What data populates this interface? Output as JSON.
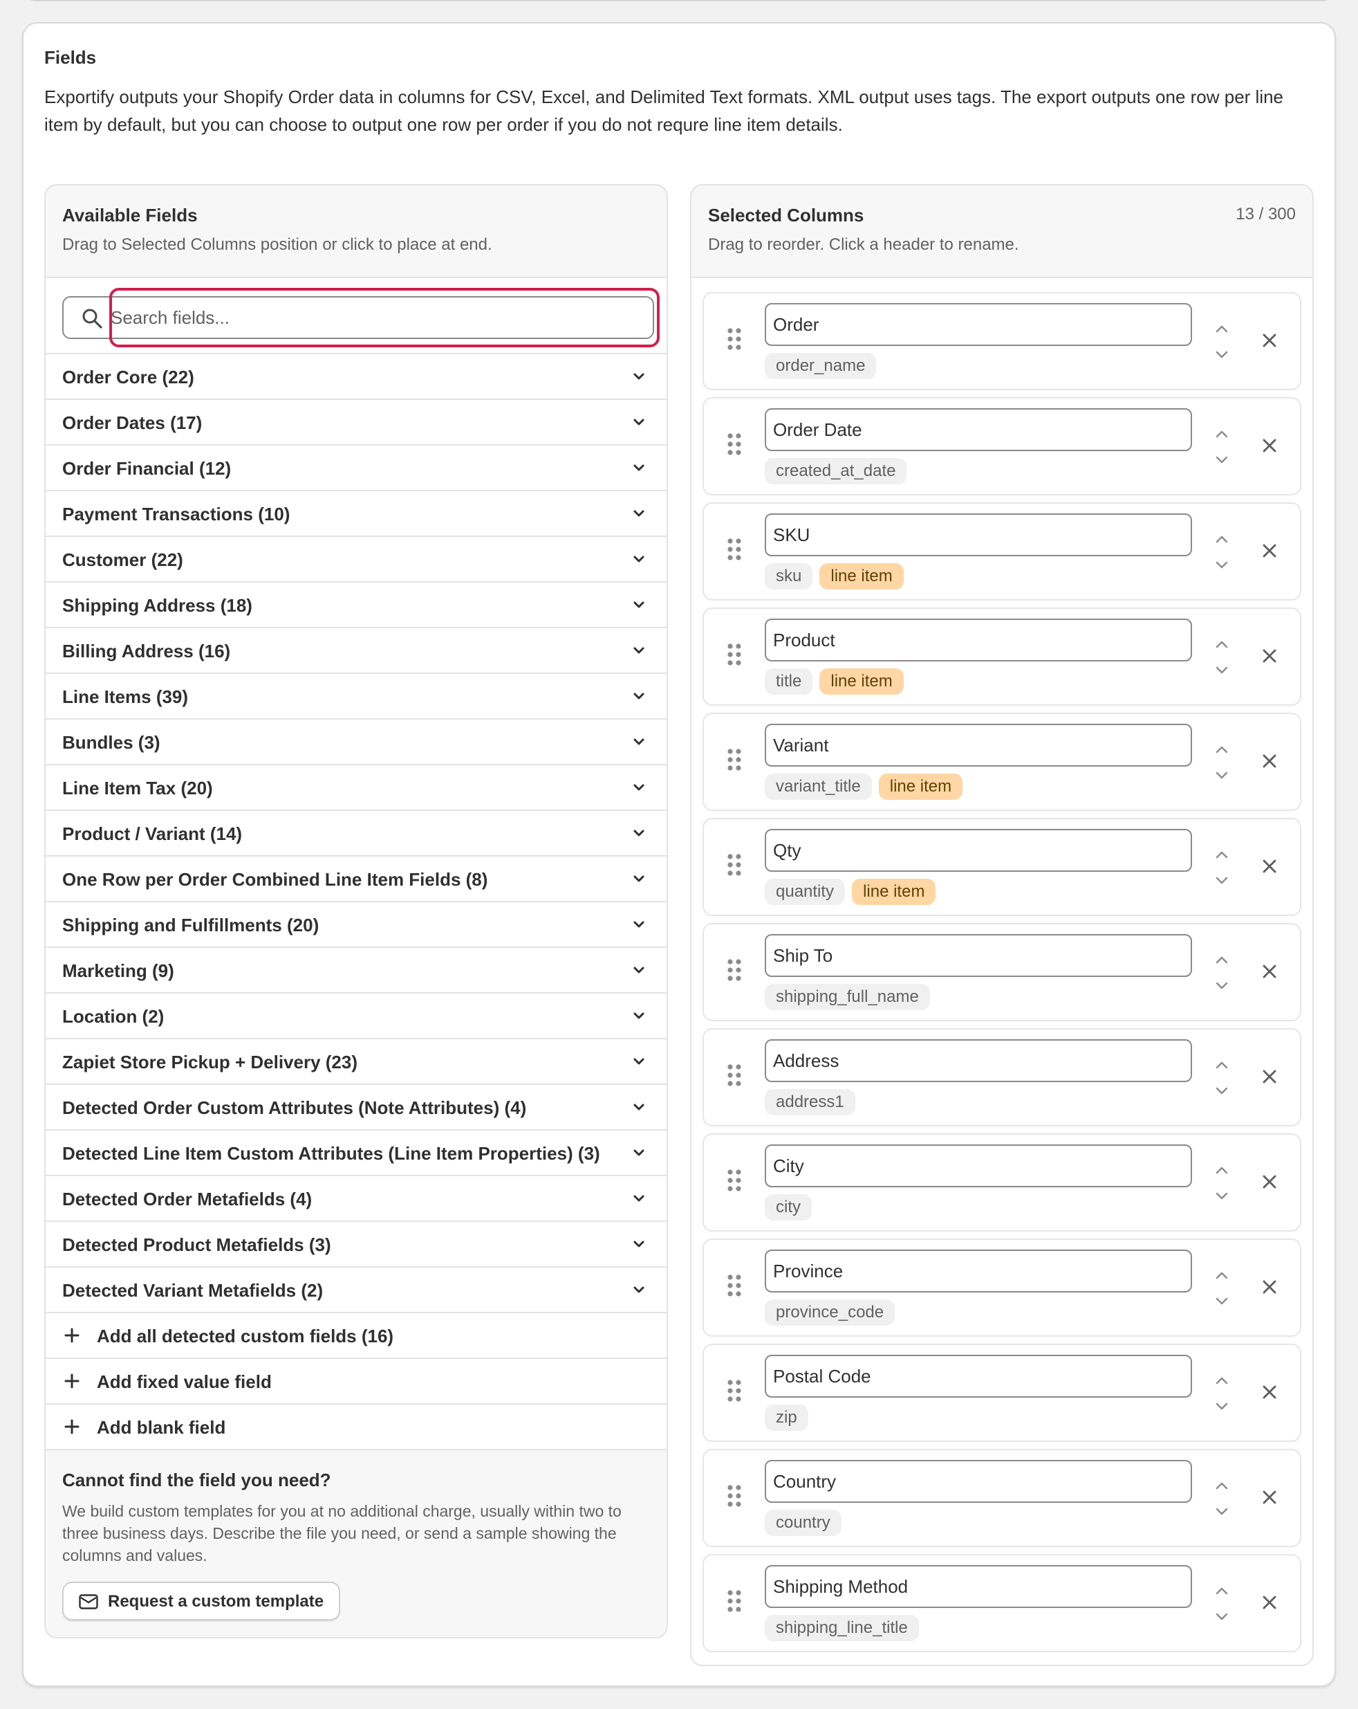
{
  "fields_section": {
    "title": "Fields",
    "description": "Exportify outputs your Shopify Order data in columns for CSV, Excel, and Delimited Text formats. XML output uses tags. The export outputs one row per line item by default, but you can choose to output one row per order if you do not requre line item details."
  },
  "available": {
    "title": "Available Fields",
    "subtitle": "Drag to Selected Columns position or click to place at end.",
    "search_placeholder": "Search fields...",
    "search_icon": "search-icon",
    "categories": [
      "Order Core (22)",
      "Order Dates (17)",
      "Order Financial (12)",
      "Payment Transactions (10)",
      "Customer (22)",
      "Shipping Address (18)",
      "Billing Address (16)",
      "Line Items (39)",
      "Bundles (3)",
      "Line Item Tax (20)",
      "Product / Variant (14)",
      "One Row per Order Combined Line Item Fields (8)",
      "Shipping and Fulfillments (20)",
      "Marketing (9)",
      "Location (2)",
      "Zapiet Store Pickup + Delivery (23)",
      "Detected Order Custom Attributes (Note Attributes) (4)",
      "Detected Line Item Custom Attributes (Line Item Properties) (3)",
      "Detected Order Metafields (4)",
      "Detected Product Metafields (3)",
      "Detected Variant Metafields (2)"
    ],
    "add_actions": [
      "Add all detected custom fields (16)",
      "Add fixed value field",
      "Add blank field"
    ],
    "help": {
      "title": "Cannot find the field you need?",
      "text": "We build custom templates for you at no additional charge, usually within two to three business days. Describe the file you need, or send a sample showing the columns and values.",
      "button_label": "Request a custom template"
    }
  },
  "selected": {
    "title": "Selected Columns",
    "subtitle": "Drag to reorder. Click a header to rename.",
    "count": "13 / 300",
    "line_item_tag": "line item",
    "columns": [
      {
        "header": "Order",
        "key": "order_name",
        "line_item": false
      },
      {
        "header": "Order Date",
        "key": "created_at_date",
        "line_item": false
      },
      {
        "header": "SKU",
        "key": "sku",
        "line_item": true
      },
      {
        "header": "Product",
        "key": "title",
        "line_item": true
      },
      {
        "header": "Variant",
        "key": "variant_title",
        "line_item": true
      },
      {
        "header": "Qty",
        "key": "quantity",
        "line_item": true
      },
      {
        "header": "Ship To",
        "key": "shipping_full_name",
        "line_item": false
      },
      {
        "header": "Address",
        "key": "address1",
        "line_item": false
      },
      {
        "header": "City",
        "key": "city",
        "line_item": false
      },
      {
        "header": "Province",
        "key": "province_code",
        "line_item": false
      },
      {
        "header": "Postal Code",
        "key": "zip",
        "line_item": false
      },
      {
        "header": "Country",
        "key": "country",
        "line_item": false
      },
      {
        "header": "Shipping Method",
        "key": "shipping_line_title",
        "line_item": false
      }
    ]
  },
  "colors": {
    "search_highlight": "#d11f4d",
    "line_item_tag_bg": "#ffd6a4",
    "card_bg": "#ffffff",
    "page_bg": "#f1f1f1"
  }
}
